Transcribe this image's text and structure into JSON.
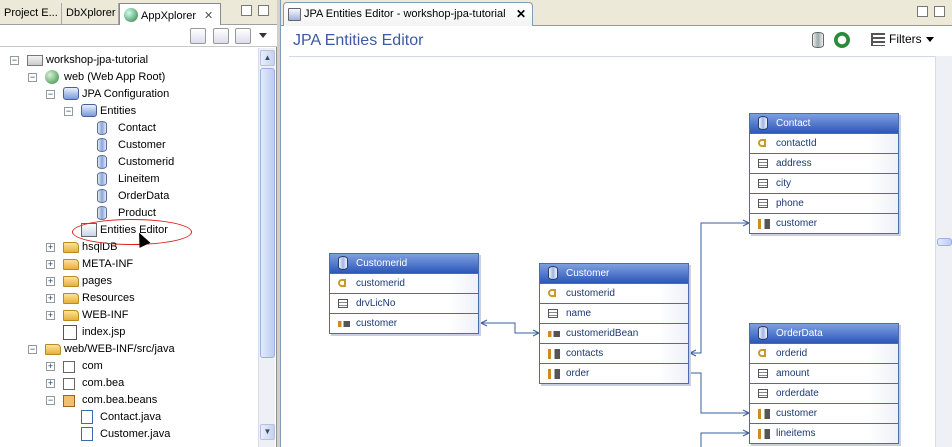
{
  "left_panel": {
    "tabs": [
      {
        "label": "Project E..."
      },
      {
        "label": "DbXplorer"
      },
      {
        "label": "AppXplorer",
        "close": "✕"
      }
    ],
    "tree": [
      {
        "label": "workshop-jpa-tutorial",
        "depth": 0,
        "expander": "−",
        "icon": "project-icon"
      },
      {
        "label": "web (Web App Root)",
        "depth": 1,
        "expander": "−",
        "icon": "web-root-icon"
      },
      {
        "label": "JPA Configuration",
        "depth": 2,
        "expander": "−",
        "icon": "jpa-config-icon"
      },
      {
        "label": "Entities",
        "depth": 3,
        "expander": "−",
        "icon": "entities-icon"
      },
      {
        "label": "Contact",
        "depth": 4,
        "expander": "",
        "icon": "entity-icon"
      },
      {
        "label": "Customer",
        "depth": 4,
        "expander": "",
        "icon": "entity-icon"
      },
      {
        "label": "Customerid",
        "depth": 4,
        "expander": "",
        "icon": "entity-icon"
      },
      {
        "label": "Lineitem",
        "depth": 4,
        "expander": "",
        "icon": "entity-icon"
      },
      {
        "label": "OrderData",
        "depth": 4,
        "expander": "",
        "icon": "entity-icon"
      },
      {
        "label": "Product",
        "depth": 4,
        "expander": "",
        "icon": "entity-icon"
      },
      {
        "label": "Entities Editor",
        "depth": 3,
        "expander": "",
        "icon": "entities-editor-icon"
      },
      {
        "label": "hsqlDB",
        "depth": 2,
        "expander": "+",
        "icon": "folder-icon"
      },
      {
        "label": "META-INF",
        "depth": 2,
        "expander": "+",
        "icon": "folder-icon"
      },
      {
        "label": "pages",
        "depth": 2,
        "expander": "+",
        "icon": "folder-icon"
      },
      {
        "label": "Resources",
        "depth": 2,
        "expander": "+",
        "icon": "folder-icon"
      },
      {
        "label": "WEB-INF",
        "depth": 2,
        "expander": "+",
        "icon": "folder-icon"
      },
      {
        "label": "index.jsp",
        "depth": 2,
        "expander": "",
        "icon": "jsp-file-icon"
      },
      {
        "label": "web/WEB-INF/src/java",
        "depth": 1,
        "expander": "−",
        "icon": "source-folder-icon"
      },
      {
        "label": "com",
        "depth": 2,
        "expander": "+",
        "icon": "package-icon"
      },
      {
        "label": "com.bea",
        "depth": 2,
        "expander": "+",
        "icon": "package-icon"
      },
      {
        "label": "com.bea.beans",
        "depth": 2,
        "expander": "−",
        "icon": "package-icon"
      },
      {
        "label": "Contact.java",
        "depth": 3,
        "expander": "",
        "icon": "java-file-icon"
      },
      {
        "label": "Customer.java",
        "depth": 3,
        "expander": "",
        "icon": "java-file-icon"
      }
    ]
  },
  "editor": {
    "tab_label": "JPA Entities Editor - workshop-jpa-tutorial",
    "tab_close": "✕",
    "title": "JPA Entities Editor",
    "filters_label": "Filters",
    "accent_color": "#2c57b8",
    "entities": [
      {
        "name": "Contact",
        "fields": [
          {
            "label": "contactId",
            "kind": "key"
          },
          {
            "label": "address",
            "kind": "attr"
          },
          {
            "label": "city",
            "kind": "attr"
          },
          {
            "label": "phone",
            "kind": "attr"
          },
          {
            "label": "customer",
            "kind": "multi"
          }
        ]
      },
      {
        "name": "Customerid",
        "fields": [
          {
            "label": "customerid",
            "kind": "key"
          },
          {
            "label": "drvLicNo",
            "kind": "attr"
          },
          {
            "label": "customer",
            "kind": "rel"
          }
        ]
      },
      {
        "name": "Customer",
        "fields": [
          {
            "label": "customerid",
            "kind": "key"
          },
          {
            "label": "name",
            "kind": "attr"
          },
          {
            "label": "customeridBean",
            "kind": "rel"
          },
          {
            "label": "contacts",
            "kind": "multi"
          },
          {
            "label": "order",
            "kind": "multi"
          }
        ]
      },
      {
        "name": "OrderData",
        "fields": [
          {
            "label": "orderid",
            "kind": "key"
          },
          {
            "label": "amount",
            "kind": "attr"
          },
          {
            "label": "orderdate",
            "kind": "attr"
          },
          {
            "label": "customer",
            "kind": "multi"
          },
          {
            "label": "lineitems",
            "kind": "multi"
          }
        ]
      }
    ]
  }
}
